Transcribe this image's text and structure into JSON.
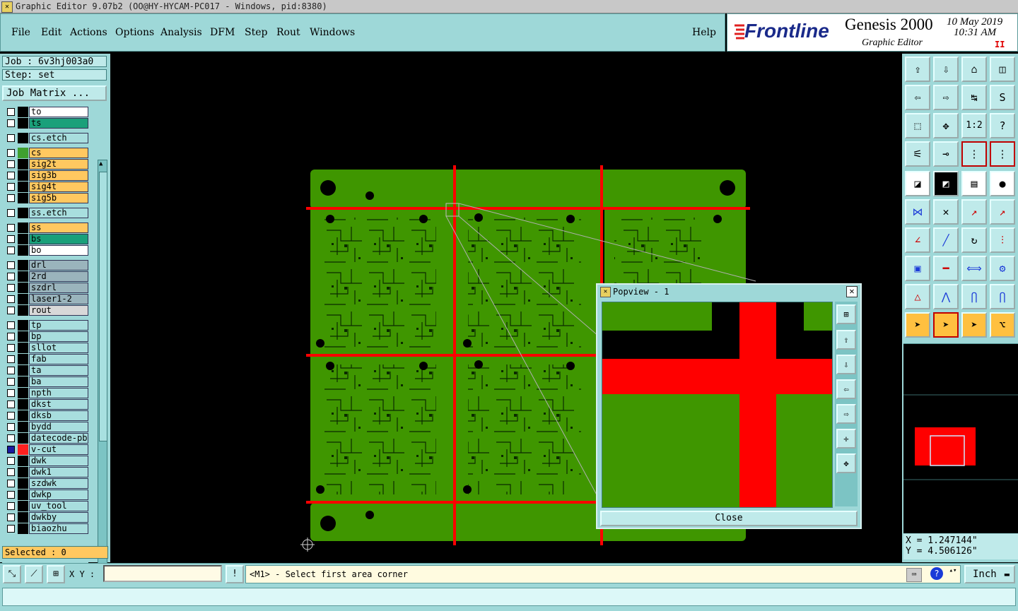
{
  "window": {
    "title": "Graphic Editor 9.07b2 (OO@HY-HYCAM-PC017 - Windows, pid:8380)"
  },
  "menu": {
    "items": [
      "File",
      "Edit",
      "Actions",
      "Options",
      "Analysis",
      "DFM",
      "Step",
      "Rout",
      "Windows"
    ],
    "help": "Help"
  },
  "branding": {
    "logo": "Frontline",
    "product": "Genesis 2000",
    "subtitle": "Graphic Editor",
    "date": "10 May 2019",
    "time": "10:31 AM",
    "pause": "II"
  },
  "left": {
    "job": "Job : 6v3hj003a0",
    "step": "Step: set",
    "job_matrix": "Job Matrix ...",
    "selected": "Selected : 0",
    "layers": [
      {
        "name": "to",
        "color": "#ffffff",
        "swatch": "#000000"
      },
      {
        "name": "ts",
        "color": "#1aa07a",
        "swatch": "#000000"
      },
      {
        "name": "cs.etch",
        "color": "#a8dede",
        "swatch": "#000000"
      },
      {
        "name": "cs",
        "color": "#ffc860",
        "swatch": "#3fa030"
      },
      {
        "name": "sig2t",
        "color": "#ffc860",
        "swatch": "#000000"
      },
      {
        "name": "sig3b",
        "color": "#ffc860",
        "swatch": "#000000"
      },
      {
        "name": "sig4t",
        "color": "#ffc860",
        "swatch": "#000000"
      },
      {
        "name": "sig5b",
        "color": "#ffc860",
        "swatch": "#000000"
      },
      {
        "name": "ss.etch",
        "color": "#a8dede",
        "swatch": "#000000"
      },
      {
        "name": "ss",
        "color": "#ffc860",
        "swatch": "#000000"
      },
      {
        "name": "bs",
        "color": "#1aa07a",
        "swatch": "#000000"
      },
      {
        "name": "bo",
        "color": "#ffffff",
        "swatch": "#000000"
      },
      {
        "name": "drl",
        "color": "#9ab4bc",
        "swatch": "#000000"
      },
      {
        "name": "2rd",
        "color": "#9ab4bc",
        "swatch": "#000000"
      },
      {
        "name": "szdrl",
        "color": "#9ab4bc",
        "swatch": "#000000"
      },
      {
        "name": "laser1-2",
        "color": "#9ab4bc",
        "swatch": "#000000"
      },
      {
        "name": "rout",
        "color": "#d8d8d8",
        "swatch": "#000000"
      },
      {
        "name": "tp",
        "color": "#a8dede",
        "swatch": "#000000"
      },
      {
        "name": "bp",
        "color": "#a8dede",
        "swatch": "#000000"
      },
      {
        "name": "sllot",
        "color": "#a8dede",
        "swatch": "#000000"
      },
      {
        "name": "fab",
        "color": "#a8dede",
        "swatch": "#000000"
      },
      {
        "name": "ta",
        "color": "#a8dede",
        "swatch": "#000000"
      },
      {
        "name": "ba",
        "color": "#a8dede",
        "swatch": "#000000"
      },
      {
        "name": "npth",
        "color": "#a8dede",
        "swatch": "#000000"
      },
      {
        "name": "dkst",
        "color": "#a8dede",
        "swatch": "#000000"
      },
      {
        "name": "dksb",
        "color": "#a8dede",
        "swatch": "#000000"
      },
      {
        "name": "bydd",
        "color": "#a8dede",
        "swatch": "#000000"
      },
      {
        "name": "datecode-pbe",
        "color": "#a8dede",
        "swatch": "#000000"
      },
      {
        "name": "v-cut",
        "color": "#a8dede",
        "swatch": "#ff2020",
        "active": true
      },
      {
        "name": "dwk",
        "color": "#a8dede",
        "swatch": "#000000"
      },
      {
        "name": "dwk1",
        "color": "#a8dede",
        "swatch": "#000000"
      },
      {
        "name": "szdwk",
        "color": "#a8dede",
        "swatch": "#000000"
      },
      {
        "name": "dwkp",
        "color": "#a8dede",
        "swatch": "#000000"
      },
      {
        "name": "uv_tool",
        "color": "#a8dede",
        "swatch": "#000000"
      },
      {
        "name": "dwkby",
        "color": "#a8dede",
        "swatch": "#000000"
      },
      {
        "name": "biaozhu",
        "color": "#a8dede",
        "swatch": "#000000"
      }
    ]
  },
  "popview": {
    "title": "Popview - 1",
    "close": "Close"
  },
  "coords": {
    "x": "X = 1.247144\"",
    "y": "Y = 4.506126\""
  },
  "status": {
    "xy_label": "X Y :",
    "xy_value": "",
    "warn": "!",
    "message": "<M1> - Select first area corner",
    "unit": "Inch"
  },
  "colors": {
    "board_green": "#3f9600",
    "vcut_red": "#ff0000",
    "panel_teal": "#9ed8d8"
  }
}
